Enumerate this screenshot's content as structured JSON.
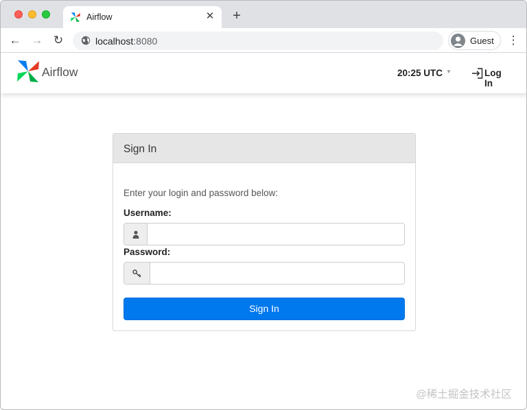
{
  "browser": {
    "tab": {
      "title": "Airflow",
      "close": "✕"
    },
    "new_tab": "+",
    "nav": {
      "back": "←",
      "forward": "→",
      "reload": "↻"
    },
    "address": {
      "host": "localhost",
      "port": ":8080"
    },
    "profile": {
      "label": "Guest"
    },
    "menu": "⋮",
    "traffic_lights": {
      "close": "#fe5f57",
      "minimize": "#febc2e",
      "zoom": "#28c840"
    }
  },
  "navbar": {
    "brand": "Airflow",
    "clock": "20:25 UTC",
    "caret": "▼",
    "login": "Log In"
  },
  "login_panel": {
    "title": "Sign In",
    "instruction": "Enter your login and password below:",
    "username": {
      "label": "Username:",
      "value": "",
      "icon": "user-icon"
    },
    "password": {
      "label": "Password:",
      "value": "",
      "icon": "key-icon"
    },
    "submit": "Sign In",
    "accent_color": "#0078ee"
  },
  "watermark": "@稀土掘金技术社区"
}
